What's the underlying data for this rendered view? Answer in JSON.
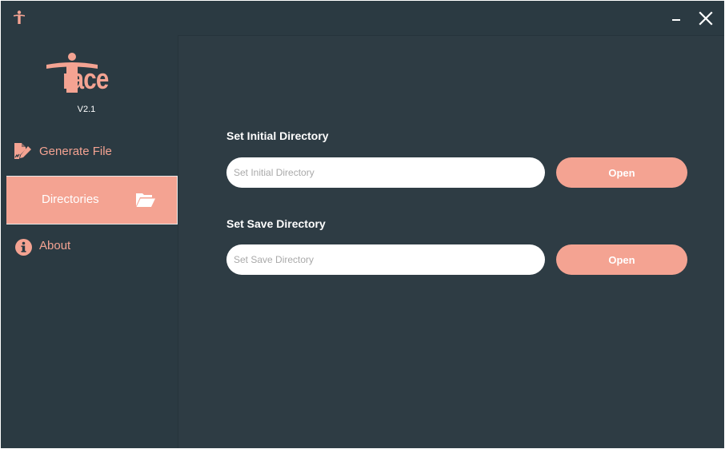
{
  "app": {
    "logo_text": "race",
    "version": "V2.1",
    "accent_color": "#f4a392",
    "background_color": "#2b3a42"
  },
  "titlebar": {
    "app_icon": "person-t-icon",
    "minimize_icon": "minimize-icon",
    "close_icon": "close-icon"
  },
  "sidebar": {
    "items": [
      {
        "label": "Generate File",
        "icon": "edit-file-icon",
        "active": false
      },
      {
        "label": "Directories",
        "icon": "folder-open-icon",
        "active": true
      },
      {
        "label": "About",
        "icon": "info-icon",
        "active": false
      }
    ]
  },
  "main": {
    "initial": {
      "title": "Set Initial Directory",
      "placeholder": "Set Initial Directory",
      "value": "",
      "button_label": "Open"
    },
    "save": {
      "title": "Set Save Directory",
      "placeholder": "Set Save Directory",
      "value": "",
      "button_label": "Open"
    }
  }
}
